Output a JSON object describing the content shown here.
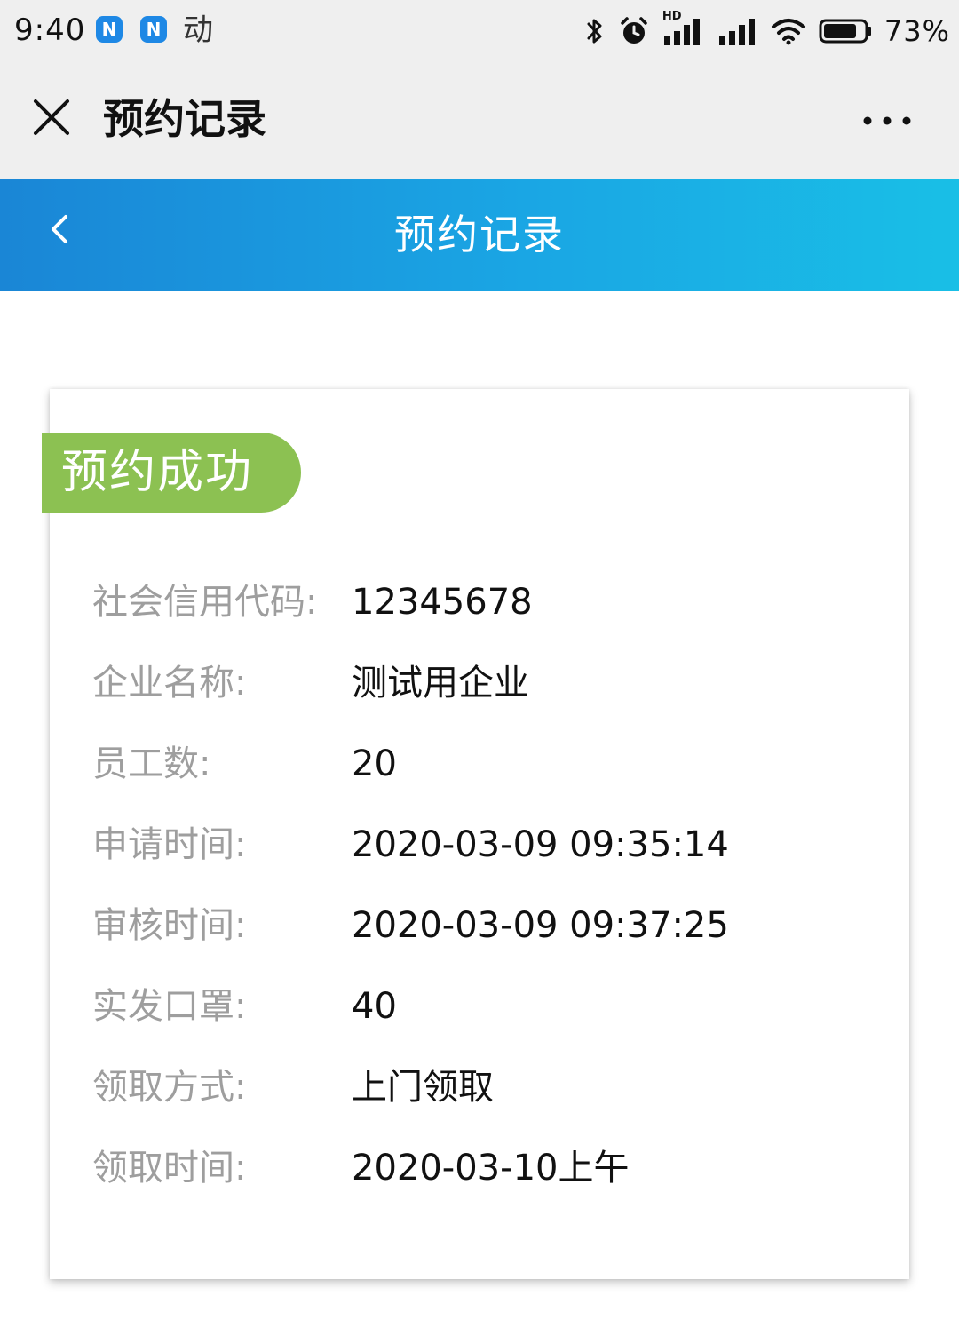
{
  "status_bar": {
    "time": "9:40",
    "notification_icons": [
      "N",
      "N"
    ],
    "extra_text": "动",
    "network_badge": "HD",
    "battery_percent": "73%"
  },
  "app_header": {
    "title": "预约记录",
    "close_icon": "close-icon",
    "more_icon": "more-dots-icon"
  },
  "nav_bar": {
    "title": "预约记录",
    "back_icon": "chevron-left-icon"
  },
  "record": {
    "status": "预约成功",
    "fields": [
      {
        "label": "社会信用代码:",
        "value": "12345678"
      },
      {
        "label": "企业名称:",
        "value": "测试用企业"
      },
      {
        "label": "员工数:",
        "value": "20"
      },
      {
        "label": "申请时间:",
        "value": "2020-03-09 09:35:14"
      },
      {
        "label": "审核时间:",
        "value": "2020-03-09 09:37:25"
      },
      {
        "label": "实发口罩:",
        "value": "40"
      },
      {
        "label": "领取方式:",
        "value": "上门领取"
      },
      {
        "label": "领取时间:",
        "value": "2020-03-10上午"
      }
    ]
  },
  "colors": {
    "nav_start": "#1a86d6",
    "nav_end": "#19bfe6",
    "status_badge": "#8cc152",
    "label_text": "#9e9e9e",
    "value_text": "#111111"
  }
}
